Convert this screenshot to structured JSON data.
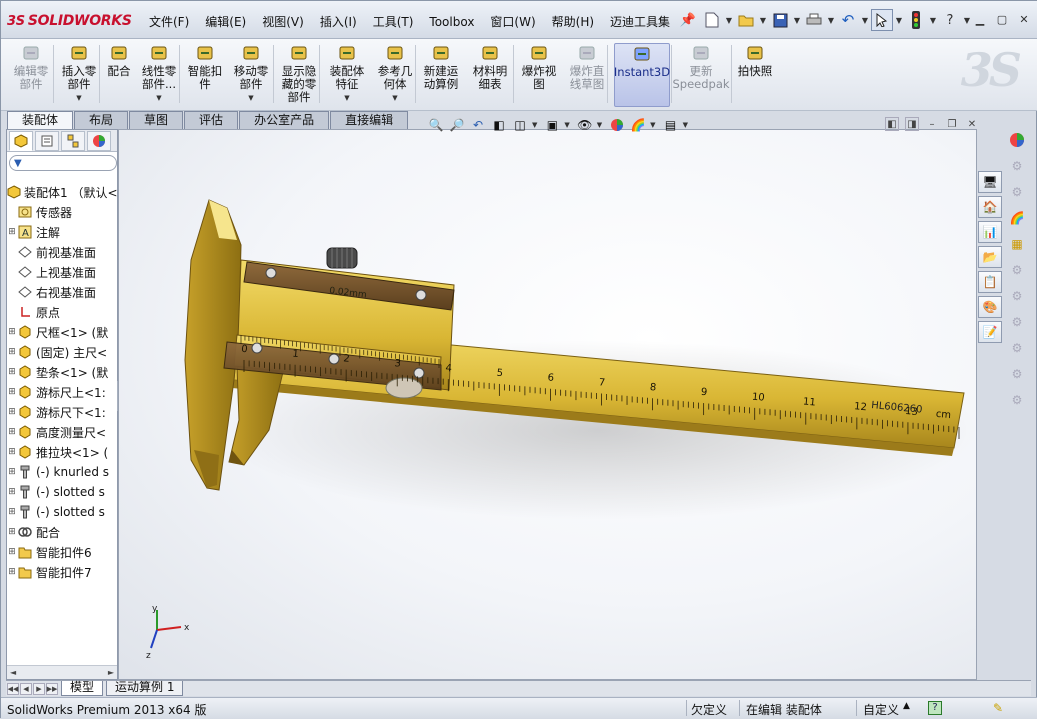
{
  "app": {
    "logo_text": "SOLIDWORKS",
    "logo_mark": "3S"
  },
  "menu": [
    "文件(F)",
    "编辑(E)",
    "视图(V)",
    "插入(I)",
    "工具(T)",
    "Toolbox",
    "窗口(W)",
    "帮助(H)",
    "迈迪工具集"
  ],
  "command_manager": [
    {
      "label": "编辑零\n部件",
      "icon": "edit-component-icon",
      "dim": true
    },
    {
      "label": "插入零\n部件",
      "icon": "insert-component-icon",
      "dropdown": true
    },
    {
      "label": "配合",
      "icon": "mate-icon"
    },
    {
      "label": "线性零\n部件...",
      "icon": "linear-pattern-icon",
      "dropdown": true
    },
    {
      "label": "智能扣\n件",
      "icon": "smart-fasteners-icon"
    },
    {
      "label": "移动零\n部件",
      "icon": "move-component-icon",
      "dropdown": true
    },
    {
      "label": "显示隐\n藏的零\n部件",
      "icon": "show-hidden-icon"
    },
    {
      "label": "装配体\n特征",
      "icon": "assembly-features-icon",
      "dropdown": true
    },
    {
      "label": "参考几\n何体",
      "icon": "reference-geometry-icon",
      "dropdown": true
    },
    {
      "label": "新建运\n动算例",
      "icon": "new-motion-study-icon"
    },
    {
      "label": "材料明\n细表",
      "icon": "bom-icon"
    },
    {
      "label": "爆炸视\n图",
      "icon": "exploded-view-icon"
    },
    {
      "label": "爆炸直\n线草图",
      "icon": "explode-line-sketch-icon",
      "dim": true
    },
    {
      "label": "Instant3D",
      "icon": "instant3d-icon",
      "active": true
    },
    {
      "label": "更新\nSpeedpak",
      "icon": "update-speedpak-icon",
      "dim": true
    },
    {
      "label": "拍快照",
      "icon": "snapshot-icon"
    }
  ],
  "tabs": [
    "装配体",
    "布局",
    "草图",
    "评估",
    "办公室产品",
    "直接编辑"
  ],
  "tree": [
    {
      "label": "装配体1 （默认<",
      "icon": "assembly-icon",
      "exp": ""
    },
    {
      "label": "传感器",
      "icon": "sensor-icon",
      "exp": ""
    },
    {
      "label": "注解",
      "icon": "annotation-icon",
      "exp": "+"
    },
    {
      "label": "前视基准面",
      "icon": "plane-icon",
      "exp": ""
    },
    {
      "label": "上视基准面",
      "icon": "plane-icon",
      "exp": ""
    },
    {
      "label": "右视基准面",
      "icon": "plane-icon",
      "exp": ""
    },
    {
      "label": "原点",
      "icon": "origin-icon",
      "exp": ""
    },
    {
      "label": "尺框<1> (默",
      "icon": "part-icon",
      "exp": "+"
    },
    {
      "label": "(固定) 主尺<",
      "icon": "part-icon",
      "exp": "+"
    },
    {
      "label": "垫条<1> (默",
      "icon": "part-icon",
      "exp": "+"
    },
    {
      "label": "游标尺上<1:",
      "icon": "part-icon",
      "exp": "+"
    },
    {
      "label": "游标尺下<1:",
      "icon": "part-icon",
      "exp": "+"
    },
    {
      "label": "高度测量尺<",
      "icon": "part-icon",
      "exp": "+"
    },
    {
      "label": "推拉块<1> (",
      "icon": "part-icon",
      "exp": "+"
    },
    {
      "label": "(-) knurled s",
      "icon": "screw-icon",
      "exp": "+"
    },
    {
      "label": "(-) slotted s",
      "icon": "screw-icon",
      "exp": "+"
    },
    {
      "label": "(-) slotted s",
      "icon": "screw-icon",
      "exp": "+"
    },
    {
      "label": "配合",
      "icon": "mates-folder-icon",
      "exp": "+"
    },
    {
      "label": "智能扣件6",
      "icon": "folder-icon",
      "exp": "+"
    },
    {
      "label": "智能扣件7",
      "icon": "folder-icon",
      "exp": "+"
    }
  ],
  "model": {
    "main_scale_numbers": [
      "0",
      "1",
      "2",
      "3",
      "4",
      "5",
      "6",
      "7",
      "8",
      "9",
      "10",
      "11",
      "12",
      "13",
      "cm"
    ],
    "engraving": "HL606260",
    "vernier_label": "0.02mm"
  },
  "triad": {
    "x": "x",
    "y": "y",
    "z": "z"
  },
  "bottom_tabs": [
    "模型",
    "运动算例 1"
  ],
  "status": {
    "product": "SolidWorks Premium 2013 x64 版",
    "defined": "欠定义",
    "editing": "在编辑 装配体",
    "custom": "自定义"
  }
}
